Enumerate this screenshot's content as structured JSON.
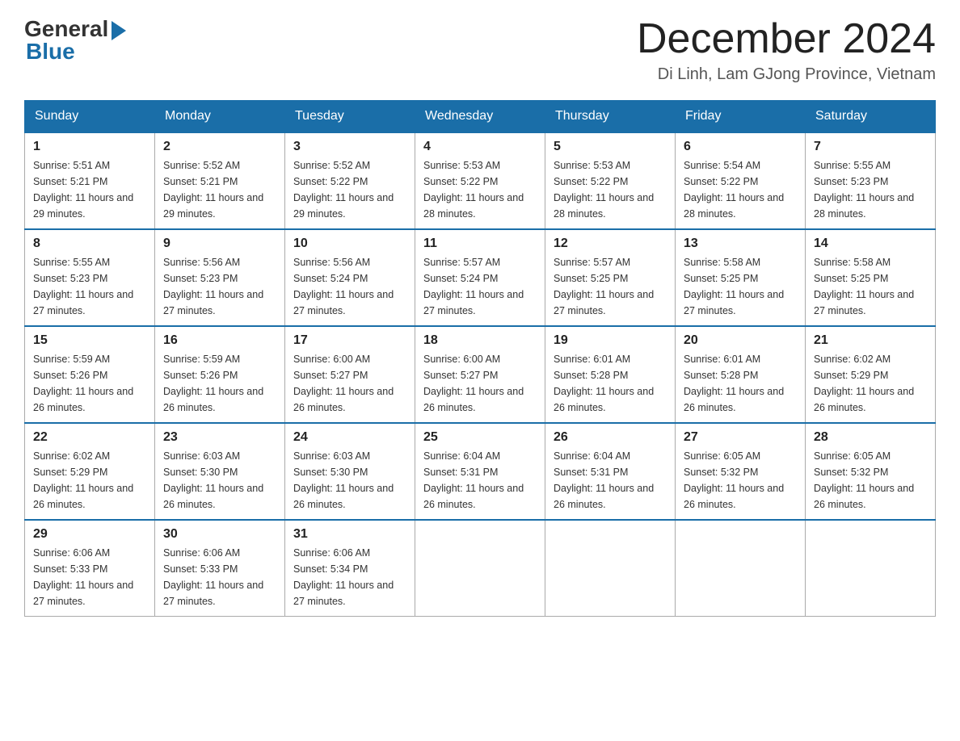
{
  "logo": {
    "general": "General",
    "blue": "Blue"
  },
  "header": {
    "month_title": "December 2024",
    "location": "Di Linh, Lam GJong Province, Vietnam"
  },
  "weekdays": [
    "Sunday",
    "Monday",
    "Tuesday",
    "Wednesday",
    "Thursday",
    "Friday",
    "Saturday"
  ],
  "weeks": [
    [
      {
        "day": "1",
        "sunrise": "5:51 AM",
        "sunset": "5:21 PM",
        "daylight": "11 hours and 29 minutes."
      },
      {
        "day": "2",
        "sunrise": "5:52 AM",
        "sunset": "5:21 PM",
        "daylight": "11 hours and 29 minutes."
      },
      {
        "day": "3",
        "sunrise": "5:52 AM",
        "sunset": "5:22 PM",
        "daylight": "11 hours and 29 minutes."
      },
      {
        "day": "4",
        "sunrise": "5:53 AM",
        "sunset": "5:22 PM",
        "daylight": "11 hours and 28 minutes."
      },
      {
        "day": "5",
        "sunrise": "5:53 AM",
        "sunset": "5:22 PM",
        "daylight": "11 hours and 28 minutes."
      },
      {
        "day": "6",
        "sunrise": "5:54 AM",
        "sunset": "5:22 PM",
        "daylight": "11 hours and 28 minutes."
      },
      {
        "day": "7",
        "sunrise": "5:55 AM",
        "sunset": "5:23 PM",
        "daylight": "11 hours and 28 minutes."
      }
    ],
    [
      {
        "day": "8",
        "sunrise": "5:55 AM",
        "sunset": "5:23 PM",
        "daylight": "11 hours and 27 minutes."
      },
      {
        "day": "9",
        "sunrise": "5:56 AM",
        "sunset": "5:23 PM",
        "daylight": "11 hours and 27 minutes."
      },
      {
        "day": "10",
        "sunrise": "5:56 AM",
        "sunset": "5:24 PM",
        "daylight": "11 hours and 27 minutes."
      },
      {
        "day": "11",
        "sunrise": "5:57 AM",
        "sunset": "5:24 PM",
        "daylight": "11 hours and 27 minutes."
      },
      {
        "day": "12",
        "sunrise": "5:57 AM",
        "sunset": "5:25 PM",
        "daylight": "11 hours and 27 minutes."
      },
      {
        "day": "13",
        "sunrise": "5:58 AM",
        "sunset": "5:25 PM",
        "daylight": "11 hours and 27 minutes."
      },
      {
        "day": "14",
        "sunrise": "5:58 AM",
        "sunset": "5:25 PM",
        "daylight": "11 hours and 27 minutes."
      }
    ],
    [
      {
        "day": "15",
        "sunrise": "5:59 AM",
        "sunset": "5:26 PM",
        "daylight": "11 hours and 26 minutes."
      },
      {
        "day": "16",
        "sunrise": "5:59 AM",
        "sunset": "5:26 PM",
        "daylight": "11 hours and 26 minutes."
      },
      {
        "day": "17",
        "sunrise": "6:00 AM",
        "sunset": "5:27 PM",
        "daylight": "11 hours and 26 minutes."
      },
      {
        "day": "18",
        "sunrise": "6:00 AM",
        "sunset": "5:27 PM",
        "daylight": "11 hours and 26 minutes."
      },
      {
        "day": "19",
        "sunrise": "6:01 AM",
        "sunset": "5:28 PM",
        "daylight": "11 hours and 26 minutes."
      },
      {
        "day": "20",
        "sunrise": "6:01 AM",
        "sunset": "5:28 PM",
        "daylight": "11 hours and 26 minutes."
      },
      {
        "day": "21",
        "sunrise": "6:02 AM",
        "sunset": "5:29 PM",
        "daylight": "11 hours and 26 minutes."
      }
    ],
    [
      {
        "day": "22",
        "sunrise": "6:02 AM",
        "sunset": "5:29 PM",
        "daylight": "11 hours and 26 minutes."
      },
      {
        "day": "23",
        "sunrise": "6:03 AM",
        "sunset": "5:30 PM",
        "daylight": "11 hours and 26 minutes."
      },
      {
        "day": "24",
        "sunrise": "6:03 AM",
        "sunset": "5:30 PM",
        "daylight": "11 hours and 26 minutes."
      },
      {
        "day": "25",
        "sunrise": "6:04 AM",
        "sunset": "5:31 PM",
        "daylight": "11 hours and 26 minutes."
      },
      {
        "day": "26",
        "sunrise": "6:04 AM",
        "sunset": "5:31 PM",
        "daylight": "11 hours and 26 minutes."
      },
      {
        "day": "27",
        "sunrise": "6:05 AM",
        "sunset": "5:32 PM",
        "daylight": "11 hours and 26 minutes."
      },
      {
        "day": "28",
        "sunrise": "6:05 AM",
        "sunset": "5:32 PM",
        "daylight": "11 hours and 26 minutes."
      }
    ],
    [
      {
        "day": "29",
        "sunrise": "6:06 AM",
        "sunset": "5:33 PM",
        "daylight": "11 hours and 27 minutes."
      },
      {
        "day": "30",
        "sunrise": "6:06 AM",
        "sunset": "5:33 PM",
        "daylight": "11 hours and 27 minutes."
      },
      {
        "day": "31",
        "sunrise": "6:06 AM",
        "sunset": "5:34 PM",
        "daylight": "11 hours and 27 minutes."
      },
      null,
      null,
      null,
      null
    ]
  ]
}
